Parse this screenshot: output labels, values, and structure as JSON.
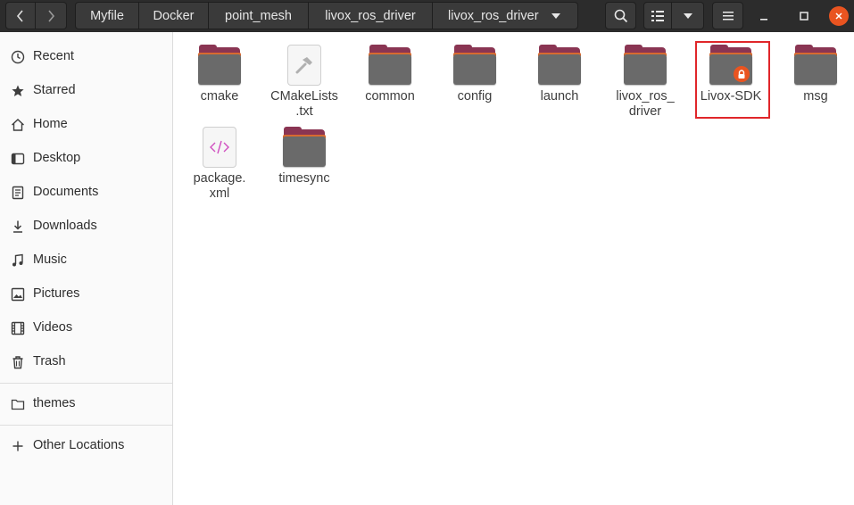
{
  "window": {
    "breadcrumbs": [
      "Myfile",
      "Docker",
      "point_mesh",
      "livox_ros_driver",
      "livox_ros_driver"
    ],
    "icons": {
      "back": "chevron-left-icon",
      "forward": "chevron-right-icon",
      "search": "search-icon",
      "view": "list-view-icon",
      "view_menu": "chevron-down-icon",
      "menu": "hamburger-icon",
      "minimize": "minimize-icon",
      "maximize": "maximize-icon",
      "close": "close-icon"
    },
    "accent_color": "#e95420"
  },
  "sidebar": {
    "items": [
      {
        "label": "Recent",
        "icon": "clock-icon"
      },
      {
        "label": "Starred",
        "icon": "star-icon"
      },
      {
        "label": "Home",
        "icon": "home-icon"
      },
      {
        "label": "Desktop",
        "icon": "desktop-icon"
      },
      {
        "label": "Documents",
        "icon": "document-icon"
      },
      {
        "label": "Downloads",
        "icon": "download-icon"
      },
      {
        "label": "Music",
        "icon": "music-icon"
      },
      {
        "label": "Pictures",
        "icon": "picture-icon"
      },
      {
        "label": "Videos",
        "icon": "film-icon"
      },
      {
        "label": "Trash",
        "icon": "trash-icon"
      }
    ],
    "bookmarks": [
      {
        "label": "themes",
        "icon": "folder-icon"
      }
    ],
    "other_locations": {
      "label": "Other Locations",
      "icon": "plus-icon"
    }
  },
  "files": [
    {
      "name": "cmake",
      "type": "folder"
    },
    {
      "name": "CMakeLists\n.txt",
      "type": "text"
    },
    {
      "name": "common",
      "type": "folder"
    },
    {
      "name": "config",
      "type": "folder"
    },
    {
      "name": "launch",
      "type": "folder"
    },
    {
      "name": "livox_ros_\ndriver",
      "type": "folder"
    },
    {
      "name": "Livox-SDK",
      "type": "folder-locked",
      "highlighted": true
    },
    {
      "name": "msg",
      "type": "folder"
    },
    {
      "name": "package.\nxml",
      "type": "xml"
    },
    {
      "name": "timesync",
      "type": "folder"
    }
  ]
}
